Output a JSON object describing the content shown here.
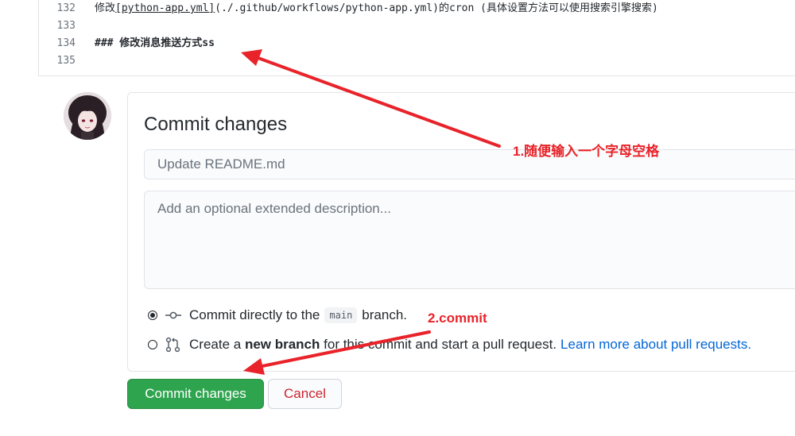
{
  "editor": {
    "lines": [
      {
        "num": "132",
        "prefix": "修改",
        "link": "[python-app.yml]",
        "suffix": "(./.github/workflows/python-app.yml)的cron (具体设置方法可以使用搜索引擎搜索)"
      },
      {
        "num": "133",
        "text": ""
      },
      {
        "num": "134",
        "text": "### 修改消息推送方式ss"
      },
      {
        "num": "135",
        "text": ""
      }
    ]
  },
  "commit": {
    "title": "Commit changes",
    "summary_placeholder": "Update README.md",
    "description_placeholder": "Add an optional extended description...",
    "option_direct": {
      "before": "Commit directly to the",
      "branch": "main",
      "after": "branch."
    },
    "option_new": {
      "before": "Create a",
      "bold": "new branch",
      "after": "for this commit and start a pull request.",
      "link": "Learn more about pull requests."
    },
    "commit_button": "Commit changes",
    "cancel_button": "Cancel"
  },
  "annotations": {
    "note1": "1.随便输入一个字母空格",
    "note2": "2.commit",
    "color": "#e8232a"
  },
  "colors": {
    "accent_green": "#2ea44f",
    "link_blue": "#0366d6",
    "cancel_red": "#cb2431"
  }
}
